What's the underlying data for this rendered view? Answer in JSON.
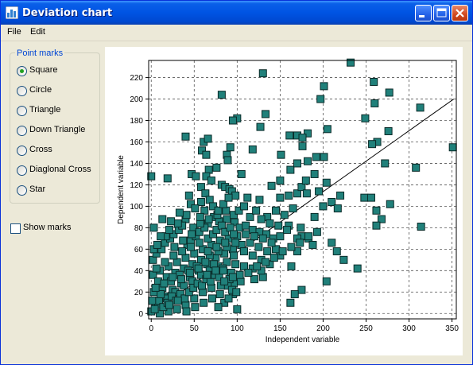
{
  "window": {
    "title": "Deviation chart"
  },
  "menu": {
    "items": [
      "File",
      "Edit"
    ]
  },
  "point_marks": {
    "title": "Point marks",
    "options": [
      "Square",
      "Circle",
      "Triangle",
      "Down Triangle",
      "Cross",
      "Diaglonal Cross",
      "Star"
    ],
    "selected": "Square"
  },
  "show_marks": {
    "label": "Show marks",
    "checked": false
  },
  "colors": {
    "title_bar": "#0054E3",
    "marker_fill": "#20807A",
    "marker_stroke": "#0A2A28",
    "group_title": "#0046D5"
  },
  "chart_data": {
    "type": "scatter",
    "xlabel": "Independent variable",
    "ylabel": "Dependent variable",
    "xlim": [
      -3,
      355
    ],
    "ylim": [
      -5,
      236
    ],
    "x_ticks": [
      0,
      50,
      100,
      150,
      200,
      250,
      300,
      350
    ],
    "y_ticks": [
      0,
      20,
      40,
      60,
      80,
      100,
      120,
      140,
      160,
      180,
      200,
      220
    ],
    "grid": true,
    "marker": "square",
    "trend_line": {
      "x": [
        0,
        352
      ],
      "y": [
        0,
        200
      ]
    },
    "points": [
      [
        232,
        234
      ],
      [
        130,
        224
      ],
      [
        259,
        216
      ],
      [
        201,
        212
      ],
      [
        197,
        200
      ],
      [
        82,
        204
      ],
      [
        277,
        206
      ],
      [
        260,
        196
      ],
      [
        313,
        192
      ],
      [
        133,
        186
      ],
      [
        100,
        182
      ],
      [
        95,
        180
      ],
      [
        249,
        182
      ],
      [
        127,
        174
      ],
      [
        170,
        166
      ],
      [
        182,
        168
      ],
      [
        176,
        156
      ],
      [
        176,
        164
      ],
      [
        161,
        166
      ],
      [
        205,
        172
      ],
      [
        276,
        170
      ],
      [
        263,
        160
      ],
      [
        351,
        155
      ],
      [
        40,
        165
      ],
      [
        61,
        160
      ],
      [
        66,
        163
      ],
      [
        59,
        152
      ],
      [
        64,
        148
      ],
      [
        88,
        148
      ],
      [
        118,
        153
      ],
      [
        151,
        148
      ],
      [
        201,
        146
      ],
      [
        257,
        158
      ],
      [
        92,
        155
      ],
      [
        89,
        143
      ],
      [
        76,
        136
      ],
      [
        67,
        134
      ],
      [
        47,
        130
      ],
      [
        52,
        128
      ],
      [
        64,
        128
      ],
      [
        70,
        124
      ],
      [
        82,
        120
      ],
      [
        86,
        118
      ],
      [
        91,
        116
      ],
      [
        94,
        114
      ],
      [
        105,
        130
      ],
      [
        98,
        110
      ],
      [
        112,
        108
      ],
      [
        126,
        106
      ],
      [
        150,
        108
      ],
      [
        160,
        110
      ],
      [
        170,
        112
      ],
      [
        175,
        118
      ],
      [
        180,
        124
      ],
      [
        190,
        130
      ],
      [
        150,
        124
      ],
      [
        162,
        134
      ],
      [
        170,
        140
      ],
      [
        182,
        142
      ],
      [
        192,
        146
      ],
      [
        272,
        140
      ],
      [
        308,
        136
      ],
      [
        0,
        128
      ],
      [
        19,
        126
      ],
      [
        204,
        122
      ],
      [
        140,
        119
      ],
      [
        44,
        110
      ],
      [
        46,
        102
      ],
      [
        58,
        104
      ],
      [
        62,
        96
      ],
      [
        40,
        88
      ],
      [
        49,
        80
      ],
      [
        66,
        84
      ],
      [
        73,
        90
      ],
      [
        79,
        86
      ],
      [
        88,
        88
      ],
      [
        97,
        85
      ],
      [
        103,
        80
      ],
      [
        110,
        82
      ],
      [
        118,
        78
      ],
      [
        126,
        76
      ],
      [
        134,
        74
      ],
      [
        142,
        70
      ],
      [
        150,
        72
      ],
      [
        160,
        82
      ],
      [
        174,
        80
      ],
      [
        190,
        90
      ],
      [
        200,
        100
      ],
      [
        210,
        104
      ],
      [
        220,
        110
      ],
      [
        248,
        108
      ],
      [
        256,
        108
      ],
      [
        262,
        96
      ],
      [
        268,
        88
      ],
      [
        262,
        82
      ],
      [
        278,
        102
      ],
      [
        314,
        81
      ],
      [
        217,
        98
      ],
      [
        195,
        114
      ],
      [
        181,
        112
      ],
      [
        175,
        72
      ],
      [
        183,
        70
      ],
      [
        170,
        70
      ],
      [
        150,
        54
      ],
      [
        163,
        44
      ],
      [
        170,
        58
      ],
      [
        188,
        64
      ],
      [
        210,
        66
      ],
      [
        216,
        58
      ],
      [
        224,
        50
      ],
      [
        240,
        42
      ],
      [
        204,
        30
      ],
      [
        175,
        22
      ],
      [
        167,
        18
      ],
      [
        162,
        10
      ],
      [
        130,
        34
      ],
      [
        120,
        32
      ],
      [
        104,
        30
      ],
      [
        96,
        28
      ],
      [
        95,
        18
      ],
      [
        85,
        10
      ],
      [
        78,
        6
      ],
      [
        100,
        4
      ],
      [
        90,
        14
      ],
      [
        80,
        18
      ],
      [
        70,
        24
      ],
      [
        60,
        20
      ],
      [
        50,
        14
      ],
      [
        40,
        8
      ],
      [
        30,
        4
      ],
      [
        20,
        2
      ],
      [
        10,
        0
      ],
      [
        0,
        2
      ],
      [
        5,
        10
      ],
      [
        15,
        16
      ],
      [
        25,
        22
      ],
      [
        35,
        28
      ],
      [
        45,
        34
      ],
      [
        55,
        40
      ],
      [
        65,
        46
      ],
      [
        75,
        52
      ],
      [
        85,
        56
      ],
      [
        95,
        60
      ],
      [
        105,
        64
      ],
      [
        115,
        66
      ],
      [
        125,
        62
      ],
      [
        135,
        58
      ],
      [
        145,
        60
      ],
      [
        140,
        66
      ],
      [
        130,
        70
      ],
      [
        120,
        72
      ],
      [
        110,
        74
      ],
      [
        100,
        72
      ],
      [
        90,
        70
      ],
      [
        80,
        68
      ],
      [
        70,
        64
      ],
      [
        60,
        60
      ],
      [
        50,
        56
      ],
      [
        40,
        52
      ],
      [
        30,
        48
      ],
      [
        20,
        44
      ],
      [
        10,
        40
      ],
      [
        2,
        36
      ],
      [
        8,
        30
      ],
      [
        18,
        34
      ],
      [
        28,
        38
      ],
      [
        38,
        42
      ],
      [
        48,
        46
      ],
      [
        58,
        50
      ],
      [
        68,
        54
      ],
      [
        78,
        58
      ],
      [
        88,
        62
      ],
      [
        98,
        66
      ],
      [
        108,
        58
      ],
      [
        118,
        54
      ],
      [
        128,
        50
      ],
      [
        138,
        46
      ],
      [
        128,
        40
      ],
      [
        118,
        42
      ],
      [
        108,
        44
      ],
      [
        98,
        46
      ],
      [
        88,
        48
      ],
      [
        78,
        44
      ],
      [
        68,
        40
      ],
      [
        58,
        36
      ],
      [
        48,
        30
      ],
      [
        38,
        26
      ],
      [
        28,
        20
      ],
      [
        18,
        14
      ],
      [
        8,
        8
      ],
      [
        3,
        20
      ],
      [
        13,
        24
      ],
      [
        23,
        30
      ],
      [
        33,
        36
      ],
      [
        43,
        40
      ],
      [
        53,
        44
      ],
      [
        63,
        48
      ],
      [
        73,
        46
      ],
      [
        83,
        42
      ],
      [
        93,
        38
      ],
      [
        103,
        36
      ],
      [
        113,
        38
      ],
      [
        123,
        44
      ],
      [
        133,
        48
      ],
      [
        143,
        52
      ],
      [
        153,
        58
      ],
      [
        163,
        62
      ],
      [
        173,
        66
      ],
      [
        183,
        72
      ],
      [
        193,
        76
      ],
      [
        2,
        50
      ],
      [
        6,
        56
      ],
      [
        12,
        60
      ],
      [
        16,
        66
      ],
      [
        22,
        70
      ],
      [
        26,
        74
      ],
      [
        32,
        78
      ],
      [
        36,
        82
      ],
      [
        42,
        64
      ],
      [
        46,
        68
      ],
      [
        52,
        72
      ],
      [
        56,
        76
      ],
      [
        62,
        80
      ],
      [
        66,
        70
      ],
      [
        72,
        74
      ],
      [
        76,
        78
      ],
      [
        82,
        82
      ],
      [
        86,
        76
      ],
      [
        92,
        80
      ],
      [
        96,
        74
      ],
      [
        4,
        4
      ],
      [
        9,
        12
      ],
      [
        14,
        6
      ],
      [
        19,
        10
      ],
      [
        24,
        16
      ],
      [
        29,
        12
      ],
      [
        34,
        18
      ],
      [
        39,
        14
      ],
      [
        44,
        20
      ],
      [
        49,
        24
      ],
      [
        54,
        28
      ],
      [
        59,
        26
      ],
      [
        64,
        32
      ],
      [
        69,
        30
      ],
      [
        74,
        36
      ],
      [
        79,
        34
      ],
      [
        84,
        40
      ],
      [
        89,
        26
      ],
      [
        94,
        22
      ],
      [
        99,
        20
      ],
      [
        1,
        12
      ],
      [
        11,
        18
      ],
      [
        21,
        8
      ],
      [
        31,
        12
      ],
      [
        41,
        2
      ],
      [
        51,
        6
      ],
      [
        61,
        10
      ],
      [
        71,
        14
      ],
      [
        81,
        26
      ],
      [
        91,
        32
      ],
      [
        6,
        42
      ],
      [
        16,
        48
      ],
      [
        26,
        54
      ],
      [
        36,
        58
      ],
      [
        46,
        62
      ],
      [
        56,
        66
      ],
      [
        66,
        58
      ],
      [
        76,
        62
      ],
      [
        86,
        66
      ],
      [
        96,
        54
      ],
      [
        3,
        60
      ],
      [
        7,
        64
      ],
      [
        17,
        72
      ],
      [
        27,
        62
      ],
      [
        37,
        68
      ],
      [
        47,
        74
      ],
      [
        57,
        84
      ],
      [
        67,
        88
      ],
      [
        77,
        92
      ],
      [
        87,
        96
      ],
      [
        5,
        24
      ],
      [
        15,
        28
      ],
      [
        25,
        34
      ],
      [
        35,
        32
      ],
      [
        45,
        38
      ],
      [
        55,
        42
      ],
      [
        65,
        36
      ],
      [
        75,
        40
      ],
      [
        85,
        30
      ],
      [
        95,
        34
      ],
      [
        58,
        118
      ],
      [
        63,
        112
      ],
      [
        68,
        106
      ],
      [
        72,
        100
      ],
      [
        78,
        96
      ],
      [
        84,
        102
      ],
      [
        90,
        108
      ],
      [
        96,
        92
      ],
      [
        102,
        96
      ],
      [
        108,
        100
      ],
      [
        135,
        90
      ],
      [
        145,
        96
      ],
      [
        155,
        92
      ],
      [
        165,
        98
      ],
      [
        158,
        78
      ],
      [
        148,
        82
      ],
      [
        138,
        84
      ],
      [
        128,
        88
      ],
      [
        115,
        90
      ],
      [
        122,
        96
      ],
      [
        11,
        72
      ],
      [
        21,
        78
      ],
      [
        31,
        84
      ],
      [
        41,
        92
      ],
      [
        51,
        98
      ],
      [
        57,
        90
      ],
      [
        23,
        86
      ],
      [
        33,
        94
      ],
      [
        13,
        88
      ],
      [
        3,
        80
      ]
    ]
  }
}
